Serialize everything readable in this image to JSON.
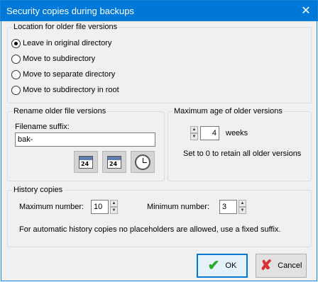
{
  "window": {
    "title": "Security copies during backups",
    "close_glyph": "✕"
  },
  "location_group": {
    "label": "Location for older file versions",
    "options": [
      {
        "label": "Leave in original directory",
        "checked": true
      },
      {
        "label": "Move to subdirectory",
        "checked": false
      },
      {
        "label": "Move to separate directory",
        "checked": false
      },
      {
        "label": "Move to subdirectory in root",
        "checked": false
      }
    ]
  },
  "rename_group": {
    "label": "Rename older file versions",
    "suffix_label": "Filename suffix:",
    "suffix_value": "bak-",
    "icon_buttons": [
      "calendar-24-icon",
      "calendar-24-bold-icon",
      "clock-icon"
    ],
    "calendar_text": "24"
  },
  "age_group": {
    "label": "Maximum age of older versions",
    "weeks_value": "4",
    "weeks_unit": "weeks",
    "hint": "Set to 0 to retain all older versions"
  },
  "history_group": {
    "label": "History copies",
    "max_label": "Maximum number:",
    "max_value": "10",
    "min_label": "Minimum number:",
    "min_value": "3",
    "note": "For automatic history copies no placeholders are allowed, use a fixed suffix."
  },
  "footer": {
    "ok_label": "OK",
    "cancel_label": "Cancel",
    "ok_glyph": "✔",
    "cancel_glyph": "✘"
  },
  "colors": {
    "titlebar": "#0078d7",
    "ok": "#2ea82e",
    "cancel": "#d93030"
  }
}
